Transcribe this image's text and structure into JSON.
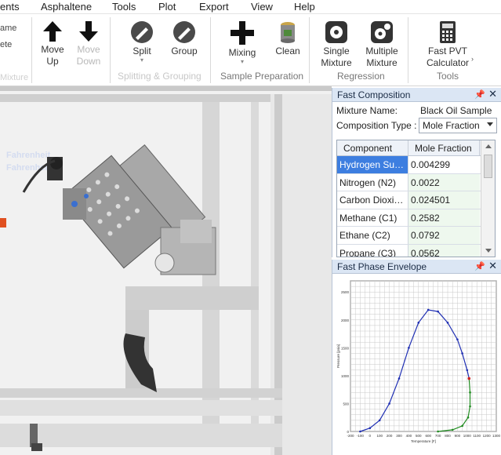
{
  "menu": {
    "items": [
      "ents",
      "Asphaltene",
      "Tools",
      "Plot",
      "Export",
      "View",
      "Help"
    ]
  },
  "ribbon": {
    "left_cut": [
      "ame",
      "ete"
    ],
    "left_cut_faded": "Mixture",
    "buttons": {
      "move_up": "Move\nUp",
      "move_down": "Move\nDown",
      "split": "Split",
      "group": "Group",
      "mixing": "Mixing",
      "clean": "Clean",
      "single_mixture": "Single\nMixture",
      "multiple_mixture": "Multiple\nMixture",
      "fast_pvt": "Fast PVT\nCalculator"
    },
    "groups": {
      "splitting": "Splitting & Grouping",
      "sample_prep": "Sample Preparation",
      "regression": "Regression",
      "tools": "Tools"
    }
  },
  "canvas": {
    "faded_texts": [
      "Fahrenheit",
      "Fahrenheit"
    ]
  },
  "fast_composition": {
    "title": "Fast Composition",
    "mixture_name_label": "Mixture Name:",
    "mixture_name_value": "Black Oil Sample",
    "composition_type_label": "Composition Type :",
    "composition_type_value": "Mole Fraction",
    "columns": [
      "Component",
      "Mole Fraction"
    ],
    "rows": [
      {
        "component": "Hydrogen Sulp...",
        "value": "0.004299"
      },
      {
        "component": "Nitrogen (N2)",
        "value": "0.0022"
      },
      {
        "component": "Carbon Dioxide...",
        "value": "0.024501"
      },
      {
        "component": "Methane (C1)",
        "value": "0.2582"
      },
      {
        "component": "Ethane (C2)",
        "value": "0.0792"
      },
      {
        "component": "Propane (C3)",
        "value": "0.0562"
      }
    ]
  },
  "fast_phase_envelope": {
    "title": "Fast Phase Envelope"
  },
  "chart_data": {
    "type": "line",
    "title": "",
    "xlabel": "Temperature [F]",
    "ylabel": "Pressure [psia]",
    "xlim": [
      -200,
      1300
    ],
    "ylim": [
      0,
      2700
    ],
    "xticks": [
      "-200",
      "-100",
      "0",
      "100",
      "200",
      "300",
      "400",
      "500",
      "600",
      "700",
      "800",
      "900",
      "1000",
      "1100",
      "1200",
      "1300"
    ],
    "yticks": [
      "0",
      "500",
      "1000",
      "1500",
      "2000",
      "2500"
    ],
    "grid": true,
    "series": [
      {
        "color": "#1f2fb3",
        "points": [
          [
            -100,
            0
          ],
          [
            0,
            60
          ],
          [
            100,
            200
          ],
          [
            200,
            500
          ],
          [
            300,
            950
          ],
          [
            400,
            1500
          ],
          [
            500,
            1950
          ],
          [
            600,
            2180
          ],
          [
            700,
            2150
          ],
          [
            800,
            1950
          ],
          [
            900,
            1650
          ],
          [
            950,
            1400
          ],
          [
            1000,
            1100
          ],
          [
            1020,
            950
          ]
        ]
      },
      {
        "color": "#1e8a1e",
        "points": [
          [
            1020,
            950
          ],
          [
            1030,
            700
          ],
          [
            1030,
            450
          ],
          [
            1010,
            250
          ],
          [
            950,
            100
          ],
          [
            850,
            30
          ],
          [
            700,
            0
          ]
        ]
      }
    ],
    "marker_colors": {
      "blue": "#1f2fb3",
      "green": "#1e8a1e",
      "red": "#d02020"
    }
  },
  "colors": {
    "panel_title_bg": "#dbe6f4",
    "selection": "#3d7ee0",
    "canvas_bg": "#f1f1f1"
  }
}
